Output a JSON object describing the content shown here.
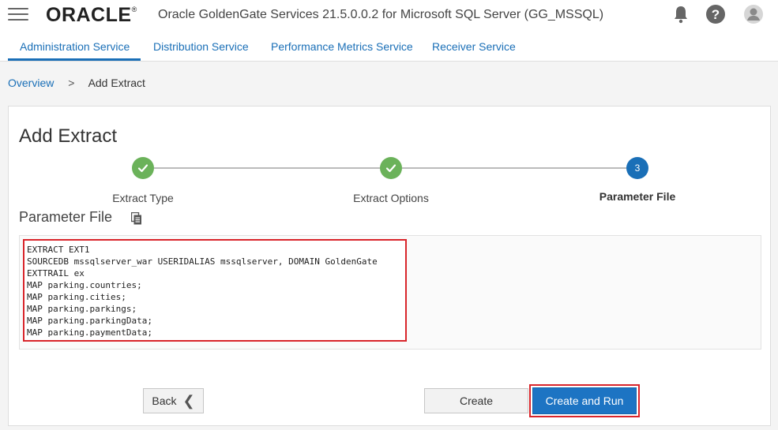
{
  "header": {
    "logo": "ORACLE",
    "logo_mark": "®",
    "title": "Oracle GoldenGate Services 21.5.0.0.2 for Microsoft SQL Server (GG_MSSQL)"
  },
  "tabs": [
    {
      "label": "Administration Service"
    },
    {
      "label": "Distribution Service"
    },
    {
      "label": "Performance Metrics Service"
    },
    {
      "label": "Receiver Service"
    }
  ],
  "breadcrumb": {
    "root": "Overview",
    "separator": ">",
    "current": "Add Extract"
  },
  "panel": {
    "title": "Add Extract"
  },
  "steps": [
    {
      "label": "Extract Type",
      "state": "done"
    },
    {
      "label": "Extract Options",
      "state": "done"
    },
    {
      "label": "Parameter File",
      "state": "current",
      "number": "3"
    }
  ],
  "parameter_file": {
    "title": "Parameter File",
    "content": "EXTRACT EXT1\nSOURCEDB mssqlserver_war USERIDALIAS mssqlserver, DOMAIN GoldenGate\nEXTTRAIL ex\nMAP parking.countries;\nMAP parking.cities;\nMAP parking.parkings;\nMAP parking.parkingData;\nMAP parking.paymentData;"
  },
  "buttons": {
    "back": "Back",
    "create": "Create",
    "create_and_run": "Create and Run"
  },
  "colors": {
    "accent": "#1a6fb7",
    "step_done": "#6bb25a",
    "highlight": "#d9252b"
  }
}
